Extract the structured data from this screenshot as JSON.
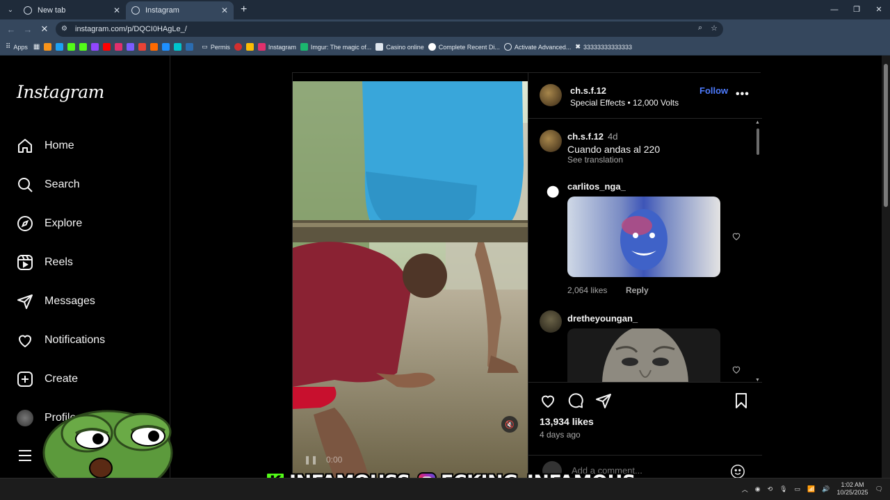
{
  "browser": {
    "tabs": [
      {
        "title": "New tab",
        "active": false
      },
      {
        "title": "Instagram",
        "active": true
      }
    ],
    "url": "instagram.com/p/DQCI0HAgLe_/",
    "bookmarks": [
      {
        "label": "Apps",
        "color": "#e8eaed"
      },
      {
        "label": "Permis",
        "color": "#9aa0a6"
      },
      {
        "label": "Instagram",
        "color": "#e1306c"
      },
      {
        "label": "Imgur: The magic of...",
        "color": "#1bb76e"
      },
      {
        "label": "Casino online",
        "color": "#dfe6ee"
      },
      {
        "label": "Complete Recent Di...",
        "color": "#dfe6ee"
      },
      {
        "label": "Activate Advanced...",
        "color": "#dfe6ee"
      },
      {
        "label": "33333333333333",
        "color": "#dfe6ee"
      }
    ],
    "bookmark_icon_colors": [
      "#f7931a",
      "#1da1f2",
      "#53fc18",
      "#53fc18",
      "#9146ff",
      "#ff0000",
      "#e1306c",
      "#7b5cff",
      "#ea4335",
      "#ff6a00",
      "#1e90ff",
      "#00c4cc",
      "#2b6cb0"
    ]
  },
  "sidebar": {
    "logo": "Instagram",
    "items": [
      {
        "label": "Home",
        "icon": "home-icon"
      },
      {
        "label": "Search",
        "icon": "search-icon"
      },
      {
        "label": "Explore",
        "icon": "compass-icon"
      },
      {
        "label": "Reels",
        "icon": "reels-icon"
      },
      {
        "label": "Messages",
        "icon": "send-icon"
      },
      {
        "label": "Notifications",
        "icon": "heart-icon"
      },
      {
        "label": "Create",
        "icon": "plus-icon"
      },
      {
        "label": "Profile",
        "icon": "avatar"
      }
    ],
    "more_icon": "hamburger-icon"
  },
  "post": {
    "author": "ch.s.f.12",
    "subtitle": "Special Effects • 12,000 Volts",
    "follow_label": "Follow",
    "caption": {
      "user": "ch.s.f.12",
      "time": "4d",
      "text": "Cuando andas al 220",
      "see_translation": "See translation"
    },
    "comments": [
      {
        "user": "carlitos_nga_",
        "likes": "2,064 likes",
        "reply": "Reply"
      },
      {
        "user": "dretheyoungan_"
      }
    ],
    "likes": "13,934 likes",
    "posted": "4 days ago",
    "video_time": "0:00",
    "add_comment_placeholder": "Add a comment..."
  },
  "overlay": {
    "kick_handle": "INFAMOUSS",
    "instagram_handle": "FCKING_INFAMOUS",
    "brand_colors": {
      "kick": "#53fc18",
      "instagram": "#d62976"
    }
  },
  "taskbar": {
    "time": "1:02 AM",
    "date": "10/25/2025"
  },
  "colors": {
    "accent": "#4e7cff",
    "chrome_bg": "#35475d",
    "tab_strip": "#1f2b3a"
  }
}
